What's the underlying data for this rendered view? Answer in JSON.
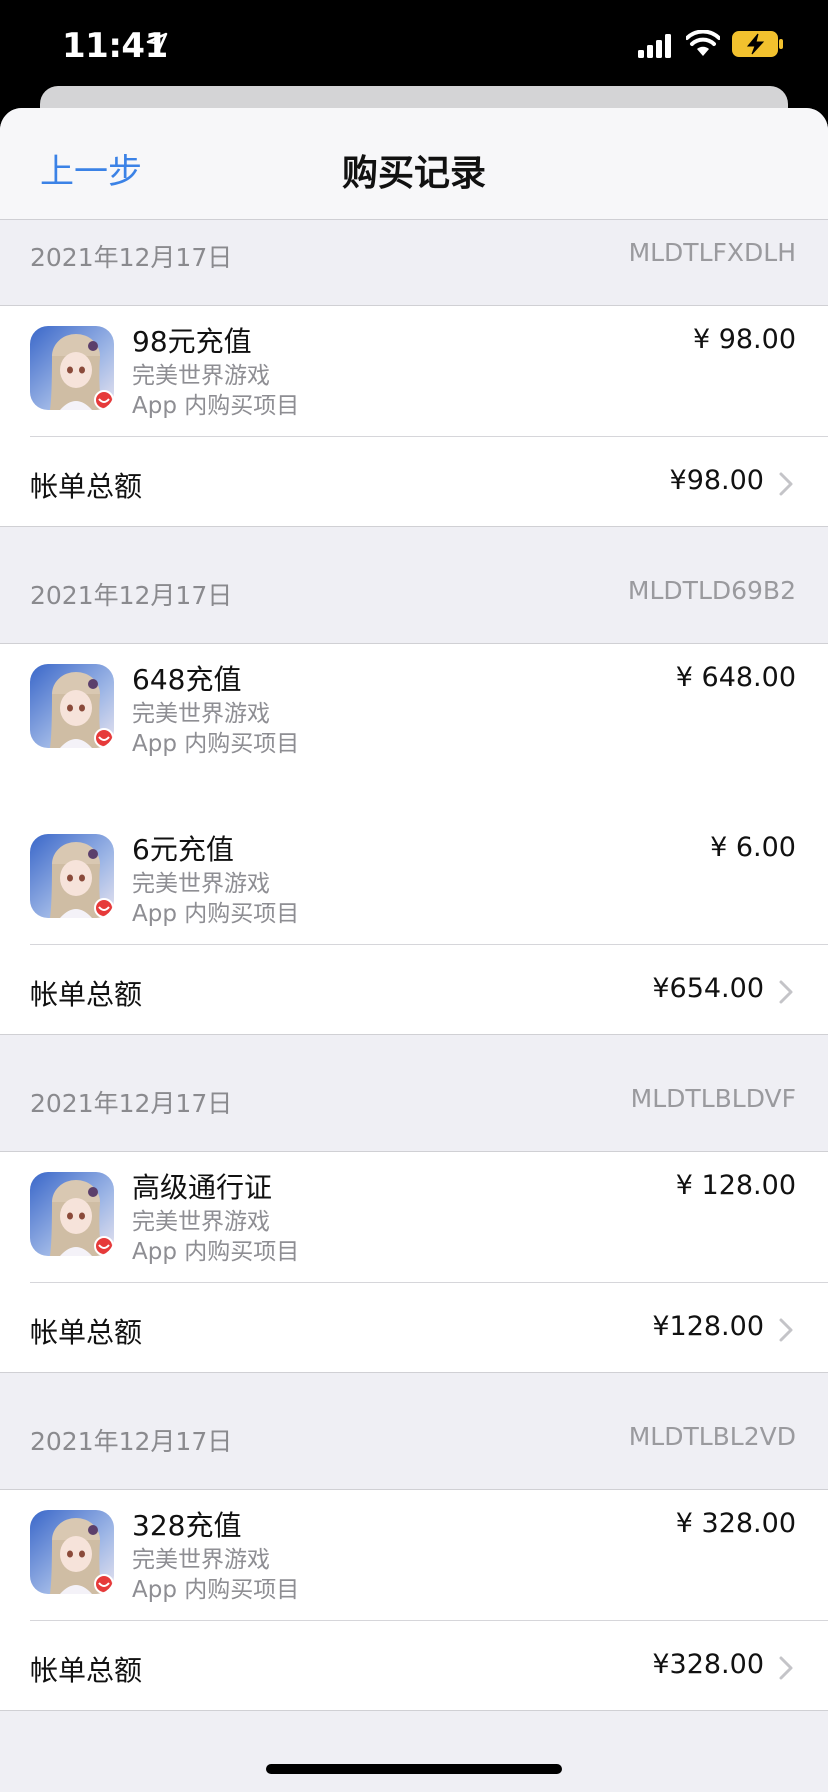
{
  "status": {
    "time": "11:41"
  },
  "nav": {
    "back": "上一步",
    "title": "购买记录"
  },
  "sections": [
    {
      "date": "2021年12月17日",
      "order_id": "MLDTLFXDLH",
      "items": [
        {
          "title": "98元充值",
          "app": "完美世界游戏",
          "kind": "App 内购买项目",
          "price": "¥ 98.00"
        }
      ],
      "total_label": "帐单总额",
      "total": "¥98.00"
    },
    {
      "date": "2021年12月17日",
      "order_id": "MLDTLD69B2",
      "items": [
        {
          "title": "648充值",
          "app": "完美世界游戏",
          "kind": "App 内购买项目",
          "price": "¥ 648.00"
        },
        {
          "title": "6元充值",
          "app": "完美世界游戏",
          "kind": "App 内购买项目",
          "price": "¥ 6.00"
        }
      ],
      "total_label": "帐单总额",
      "total": "¥654.00"
    },
    {
      "date": "2021年12月17日",
      "order_id": "MLDTLBLDVF",
      "items": [
        {
          "title": "高级通行证",
          "app": "完美世界游戏",
          "kind": "App 内购买项目",
          "price": "¥ 128.00"
        }
      ],
      "total_label": "帐单总额",
      "total": "¥128.00"
    },
    {
      "date": "2021年12月17日",
      "order_id": "MLDTLBL2VD",
      "items": [
        {
          "title": "328充值",
          "app": "完美世界游戏",
          "kind": "App 内购买项目",
          "price": "¥ 328.00"
        }
      ],
      "total_label": "帐单总额",
      "total": "¥328.00"
    }
  ],
  "colors": {
    "accent": "#3b82e6",
    "background": "#efeff4"
  },
  "icons": [
    "location-arrow-icon",
    "cellular-signal-icon",
    "wifi-icon",
    "battery-charging-icon",
    "chevron-right-icon",
    "app-icon"
  ]
}
